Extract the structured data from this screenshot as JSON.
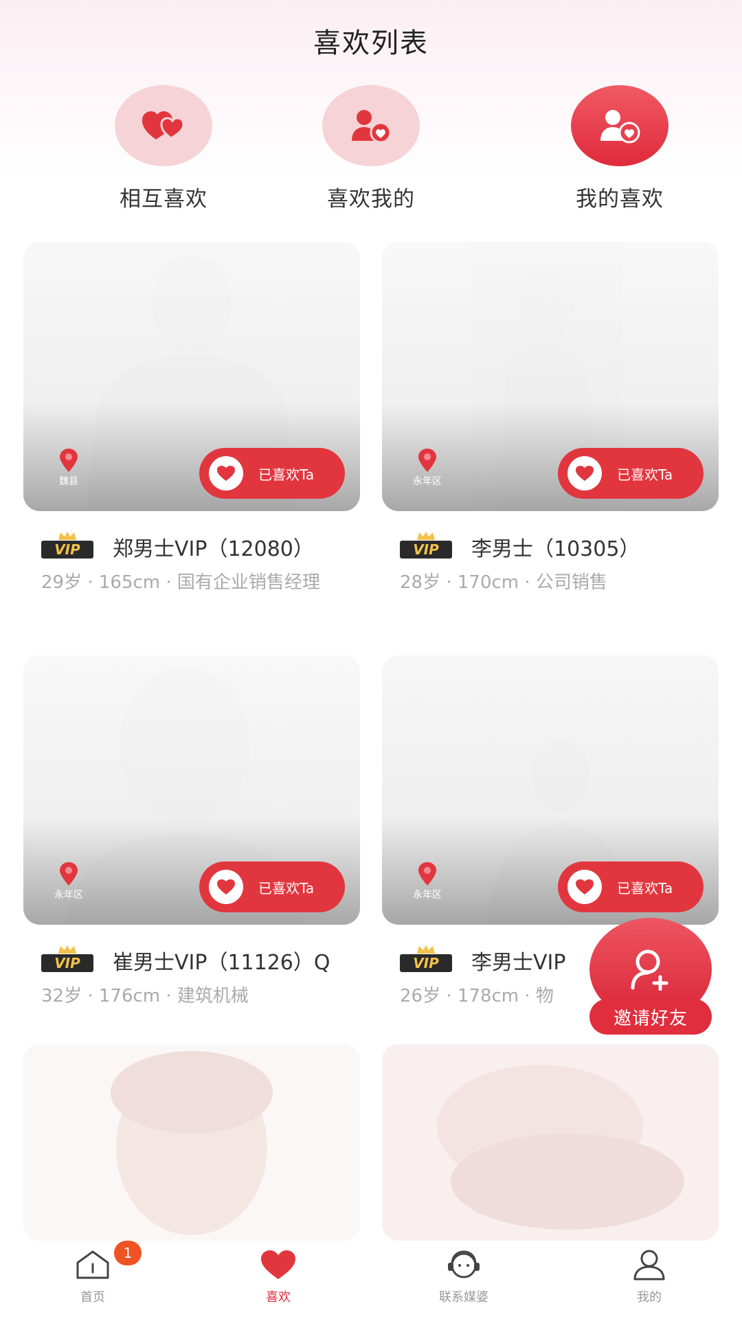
{
  "header": {
    "title": "喜欢列表"
  },
  "categories": [
    {
      "label": "相互喜欢",
      "icon": "two-hearts-icon",
      "active": false
    },
    {
      "label": "喜欢我的",
      "icon": "person-heart-icon",
      "active": false
    },
    {
      "label": "我的喜欢",
      "icon": "person-heart-icon",
      "active": true
    }
  ],
  "cards": [
    {
      "name": "郑男士VIP（12080）",
      "info": "29岁 · 165cm · 国有企业销售经理",
      "location": "魏县",
      "liked_label": "已喜欢Ta",
      "vip": true
    },
    {
      "name": "李男士（10305）",
      "info": "28岁 · 170cm · 公司销售",
      "location": "永年区",
      "liked_label": "已喜欢Ta",
      "vip": true
    },
    {
      "name": "崔男士VIP（11126）Q",
      "info": "32岁 · 176cm · 建筑机械",
      "location": "永年区",
      "liked_label": "已喜欢Ta",
      "vip": true
    },
    {
      "name": "李男士VIP",
      "info": "26岁 · 178cm · 物",
      "location": "永年区",
      "liked_label": "已喜欢Ta",
      "vip": true
    }
  ],
  "vip_label": "VIP",
  "invite": {
    "label": "邀请好友"
  },
  "tabbar": {
    "items": [
      {
        "label": "首页",
        "icon": "home-icon",
        "badge": "1"
      },
      {
        "label": "喜欢",
        "icon": "heart-icon"
      },
      {
        "label": "联系媒婆",
        "icon": "headset-icon"
      },
      {
        "label": "我的",
        "icon": "user-icon"
      }
    ],
    "active_index": 1
  },
  "colors": {
    "accent": "#e02a3c",
    "pink_bg": "#f6d3d6",
    "vip_gold": "#f2c24a"
  }
}
